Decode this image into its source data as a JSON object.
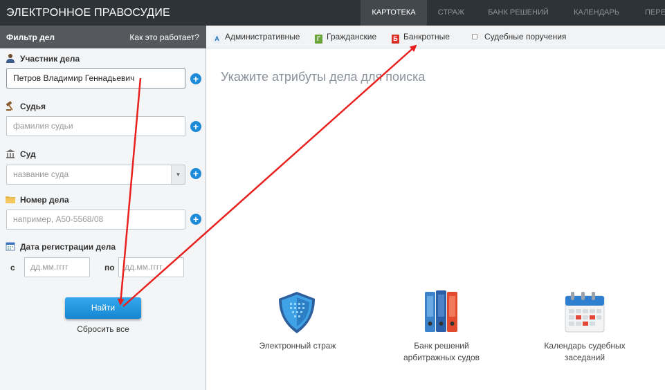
{
  "header": {
    "app_title": "ЭЛЕКТРОННОЕ ПРАВОСУДИЕ",
    "nav": [
      "КАРТОТЕКА",
      "СТРАЖ",
      "БАНК РЕШЕНИЙ",
      "КАЛЕНДАРЬ",
      "ПЕРЕ"
    ],
    "active_nav": "КАРТОТЕКА"
  },
  "filter": {
    "title": "Фильтр дел",
    "how_link": "Как это работает?",
    "participant": {
      "label": "Участник дела",
      "value": "Петров Владимир Геннадьевич"
    },
    "judge": {
      "label": "Судья",
      "placeholder": "фамилия судьи"
    },
    "court": {
      "label": "Суд",
      "placeholder": "название суда"
    },
    "case_number": {
      "label": "Номер дела",
      "placeholder": "например, А50-5568/08"
    },
    "reg_date": {
      "label": "Дата регистрации дела",
      "from_label": "с",
      "to_label": "по",
      "from_placeholder": "дд.мм.гггг",
      "to_placeholder": "дд.мм.гггг"
    },
    "find_button": "Найти",
    "reset_link": "Сбросить все"
  },
  "case_types": [
    {
      "letter": "А",
      "label": "Административные",
      "color": "#1c6fb8"
    },
    {
      "letter": "Г",
      "label": "Гражданские",
      "color": "#6aa43a"
    },
    {
      "letter": "Б",
      "label": "Банкротные",
      "color": "#d9322b"
    },
    {
      "letter": "",
      "label": "Судебные поручения",
      "color": "#888888"
    }
  ],
  "main": {
    "hint": "Укажите атрибуты дела для поиска",
    "services": [
      {
        "icon": "shield-icon",
        "line1": "Электронный страж",
        "line2": ""
      },
      {
        "icon": "binders-icon",
        "line1": "Банк решений",
        "line2": "арбитражных судов"
      },
      {
        "icon": "calendar-icon",
        "line1": "Календарь судебных",
        "line2": "заседаний"
      }
    ]
  },
  "colors": {
    "topbar": "#2e3337",
    "accent": "#1d8bd8",
    "annotation_arrow": "#e8201e"
  }
}
